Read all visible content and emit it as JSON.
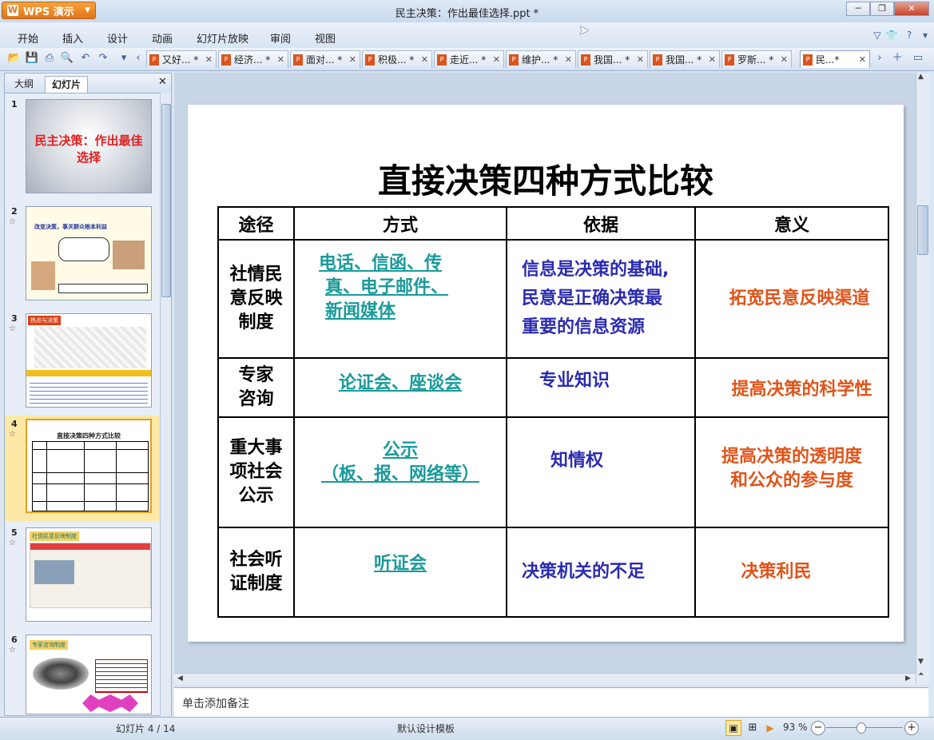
{
  "window": {
    "app_button": "WPS 演示",
    "title": "民主决策：作出最佳选择.ppt *",
    "controls": [
      "─",
      "❐",
      "✕"
    ]
  },
  "menu": {
    "items": [
      "开始",
      "插入",
      "设计",
      "动画",
      "幻灯片放映",
      "审阅",
      "视图"
    ]
  },
  "tabs": [
    {
      "label": "又好..."
    },
    {
      "label": "经济..."
    },
    {
      "label": "面对..."
    },
    {
      "label": "积极..."
    },
    {
      "label": "走近..."
    },
    {
      "label": "维护..."
    },
    {
      "label": "我国..."
    },
    {
      "label": "我国..."
    },
    {
      "label": "罗斯..."
    },
    {
      "label": "民...*"
    }
  ],
  "pane": {
    "tab_outline": "大纲",
    "tab_slides": "幻灯片",
    "close": "✕",
    "thumbnails": [
      {
        "num": "1",
        "title": "民主决策：作出最佳选择"
      },
      {
        "num": "2",
        "title": "改变决策，事关群众根本利益"
      },
      {
        "num": "3",
        "title": "热点与决策"
      },
      {
        "num": "4",
        "title": "直接决策四种方式比较"
      },
      {
        "num": "5",
        "title": "社情民意反映制度"
      },
      {
        "num": "6",
        "title": "专家咨询制度"
      }
    ]
  },
  "slide": {
    "title": "直接决策四种方式比较",
    "table": {
      "headers": [
        "途径",
        "方式",
        "依据",
        "意义"
      ],
      "rows": [
        {
          "path": "社情民意反映制度",
          "path_lines": [
            "社情民",
            "意反映",
            "制度"
          ],
          "method_lines": [
            "电话、信函、传",
            "真、电子邮件、",
            "新闻媒体"
          ],
          "basis_lines": [
            "信息是决策的基础,",
            "民意是正确决策最",
            "重要的信息资源"
          ],
          "meaning_lines": [
            "拓宽民意反映渠道"
          ]
        },
        {
          "path_lines": [
            "专家",
            "咨询"
          ],
          "method_lines": [
            "论证会、座谈会"
          ],
          "basis_lines": [
            "专业知识"
          ],
          "meaning_lines": [
            "提高决策的科学性"
          ]
        },
        {
          "path_lines": [
            "重大事",
            "项社会",
            "公示"
          ],
          "method_lines": [
            "公示",
            "（板、报、网络等）"
          ],
          "basis_lines": [
            "知情权"
          ],
          "meaning_lines": [
            "提高决策的透明度",
            "和公众的参与度"
          ]
        },
        {
          "path_lines": [
            "社会听",
            "证制度"
          ],
          "method_lines": [
            "听证会"
          ],
          "basis_lines": [
            "决策机关的不足"
          ],
          "meaning_lines": [
            "决策利民"
          ]
        }
      ]
    }
  },
  "notes_placeholder": "单击添加备注",
  "status": {
    "slide_counter": "幻灯片 4 / 14",
    "template": "默认设计模板",
    "zoom": "93 %"
  }
}
